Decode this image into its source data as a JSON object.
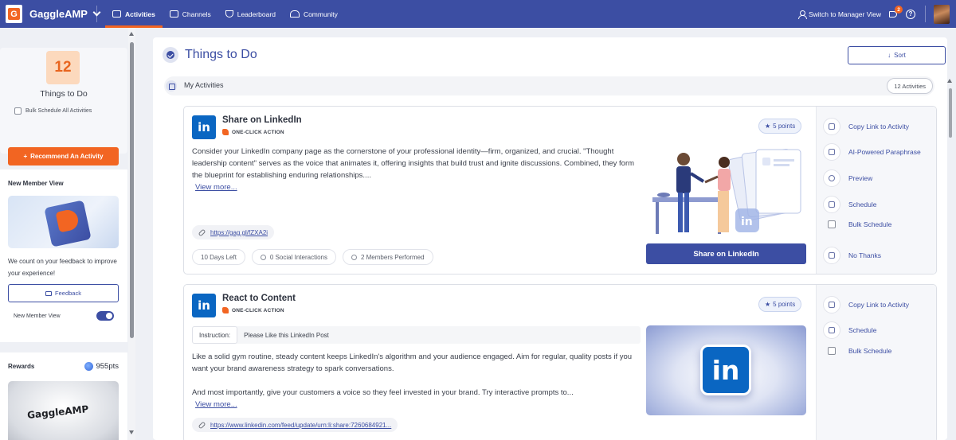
{
  "topnav": {
    "brand": "GaggleAMP",
    "logo_letter": "G",
    "tabs": [
      {
        "label": "Activities",
        "icon": "activities-icon",
        "active": true
      },
      {
        "label": "Channels",
        "icon": "channels-icon",
        "active": false
      },
      {
        "label": "Leaderboard",
        "icon": "trophy-icon",
        "active": false
      },
      {
        "label": "Community",
        "icon": "community-icon",
        "active": false
      }
    ],
    "switch_manager": "Switch to Manager View",
    "notification_count": "2",
    "help": "?"
  },
  "sidebar": {
    "todo_count": "12",
    "todo_label": "Things to Do",
    "bulk_schedule_label": "Bulk Schedule All Activities",
    "recommend_label": "Recommend An Activity",
    "member_title": "New Member View",
    "feedback_text": "We count on your feedback to improve your experience!",
    "feedback_button": "Feedback",
    "toggle_label": "New Member View",
    "toggle_on": true,
    "rewards_title": "Rewards",
    "rewards_points": "955pts",
    "hat_brand": "GaggleAMP"
  },
  "main": {
    "title": "Things to Do",
    "sort_label": "Sort",
    "my_activities_label": "My Activities",
    "activities_count": "12 Activities"
  },
  "activities": [
    {
      "title": "Share on LinkedIn",
      "action_type": "ONE-CLICK ACTION",
      "points": "5 points",
      "network_letter": "in",
      "description": "Consider your LinkedIn company page as the cornerstone of your professional identity—firm, organized, and crucial. \"Thought leadership content\" serves as the voice that animates it, offering insights that build trust and ignite discussions. Combined, they form the blueprint for establishing enduring relationships....",
      "view_more": "View more...",
      "link": "https://gag.gl/fZXA2i",
      "stats": [
        "10 Days Left",
        "0 Social Interactions",
        "2 Members Performed"
      ],
      "cta": "Share on LinkedIn",
      "side_actions": {
        "copy_link": "Copy Link to Activity",
        "paraphrase": "AI-Powered Paraphrase",
        "preview": "Preview",
        "schedule": "Schedule",
        "bulk_schedule": "Bulk Schedule",
        "no_thanks": "No Thanks"
      }
    },
    {
      "title": "React to Content",
      "action_type": "ONE-CLICK ACTION",
      "points": "5 points",
      "network_letter": "in",
      "instruction_label": "Instruction:",
      "instruction_text": "Please Like this LinkedIn Post",
      "description_p1": "Like a solid gym routine, steady content keeps LinkedIn's algorithm and your audience engaged. Aim for regular, quality posts if you want your brand awareness strategy to spark conversations.",
      "description_p2": "And most importantly, give your customers a voice so they feel invested in your brand. Try interactive prompts to...",
      "view_more": "View more...",
      "link": "https://www.linkedin.com/feed/update/urn:li:share:7260684921...",
      "side_actions": {
        "copy_link": "Copy Link to Activity",
        "schedule": "Schedule",
        "bulk_schedule": "Bulk Schedule"
      }
    }
  ],
  "colors": {
    "primary": "#3c4ea3",
    "accent": "#f26522",
    "linkedin": "#0a66c2"
  }
}
